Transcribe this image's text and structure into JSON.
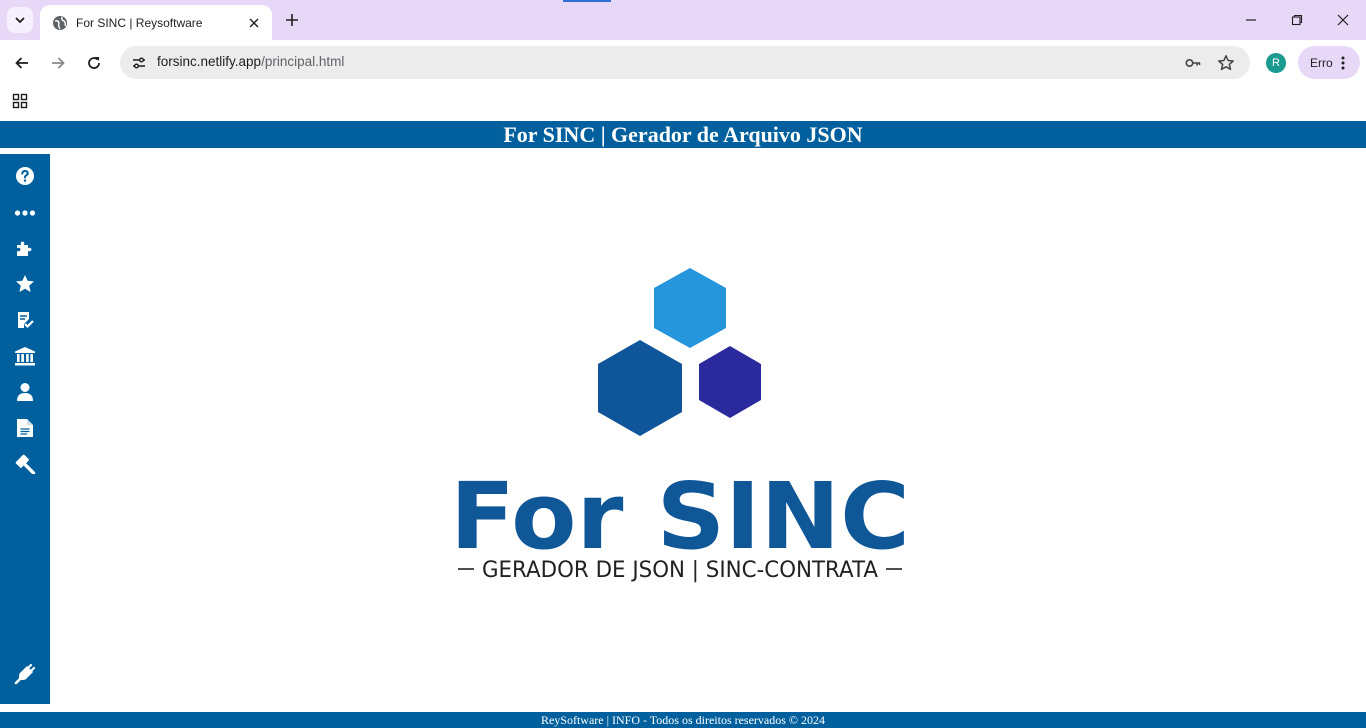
{
  "browser": {
    "tab": {
      "title": "For SINC | Reysoftware",
      "favicon": "globe-icon",
      "close_icon": "close-icon"
    },
    "new_tab_icon": "plus-icon",
    "window_controls": [
      "minimize-icon",
      "restore-icon",
      "close-icon"
    ],
    "nav": [
      "back-icon",
      "forward-icon",
      "reload-icon"
    ],
    "address": {
      "domain": "forsinc.netlify.app",
      "path": "/principal.html"
    },
    "omnibox_icons": [
      "key-icon",
      "star-icon"
    ],
    "profile_initial": "R",
    "profile_color": "#1b9a8f",
    "error_chip": "Erro",
    "bookmarks_bar": {
      "apps_icon": "apps-grid-icon"
    }
  },
  "page": {
    "header_title": "For SINC | Gerador de Arquivo JSON",
    "accent_color": "#00609e",
    "sidebar": {
      "items": [
        "help-icon",
        "more-icon",
        "puzzle-icon",
        "star-icon",
        "checklist-icon",
        "bank-icon",
        "user-icon",
        "document-icon",
        "gavel-icon"
      ],
      "bottom_item": "plug-icon"
    },
    "logo": {
      "title": "For SINC",
      "subtitle": "GERADOR DE JSON | SINC-CONTRATA",
      "colors": {
        "light": "#2696dc",
        "medium": "#0f559a",
        "dark": "#2a2a9c",
        "text": "#0f5797"
      }
    },
    "footer": "ReySoftware | INFO - Todos os direitos reservados © 2024"
  }
}
